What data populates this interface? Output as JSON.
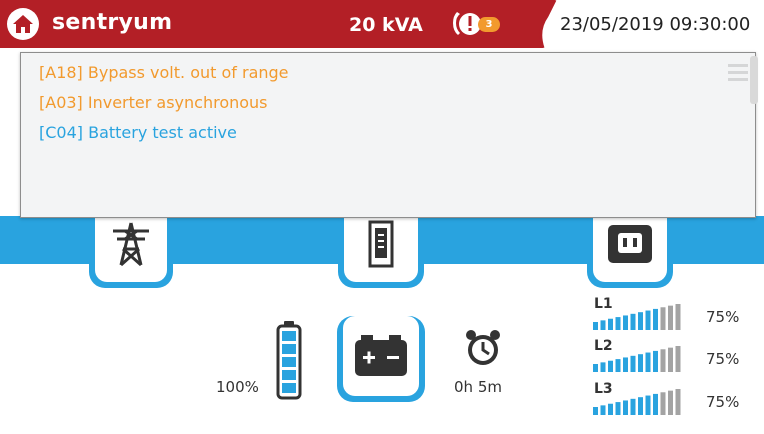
{
  "header": {
    "brand": "sentryum",
    "power_rating": "20 kVA",
    "alarm_count": "3",
    "datetime": "23/05/2019 09:30:00"
  },
  "alarms": [
    {
      "text": "[A18] Bypass volt. out of range",
      "severity": "warning"
    },
    {
      "text": "[A03] Inverter asynchronous",
      "severity": "warning"
    },
    {
      "text": "[C04] Battery test active",
      "severity": "info"
    }
  ],
  "battery": {
    "charge_label": "100%",
    "charge_fraction": 1.0,
    "autonomy_label": "0h 5m"
  },
  "loads": [
    {
      "phase": "L1",
      "percent_label": "75%",
      "fraction": 0.75
    },
    {
      "phase": "L2",
      "percent_label": "75%",
      "fraction": 0.75
    },
    {
      "phase": "L3",
      "percent_label": "75%",
      "fraction": 0.75
    }
  ],
  "colors": {
    "header_red": "#b31f26",
    "accent_blue": "#29a3df",
    "warning_orange": "#f29a2e"
  },
  "icons": [
    "home-icon",
    "alarm-icon",
    "pylon-icon",
    "ups-cabinet-icon",
    "power-socket-icon",
    "battery-icon",
    "battery-level-icon",
    "clock-icon",
    "menu-icon"
  ]
}
